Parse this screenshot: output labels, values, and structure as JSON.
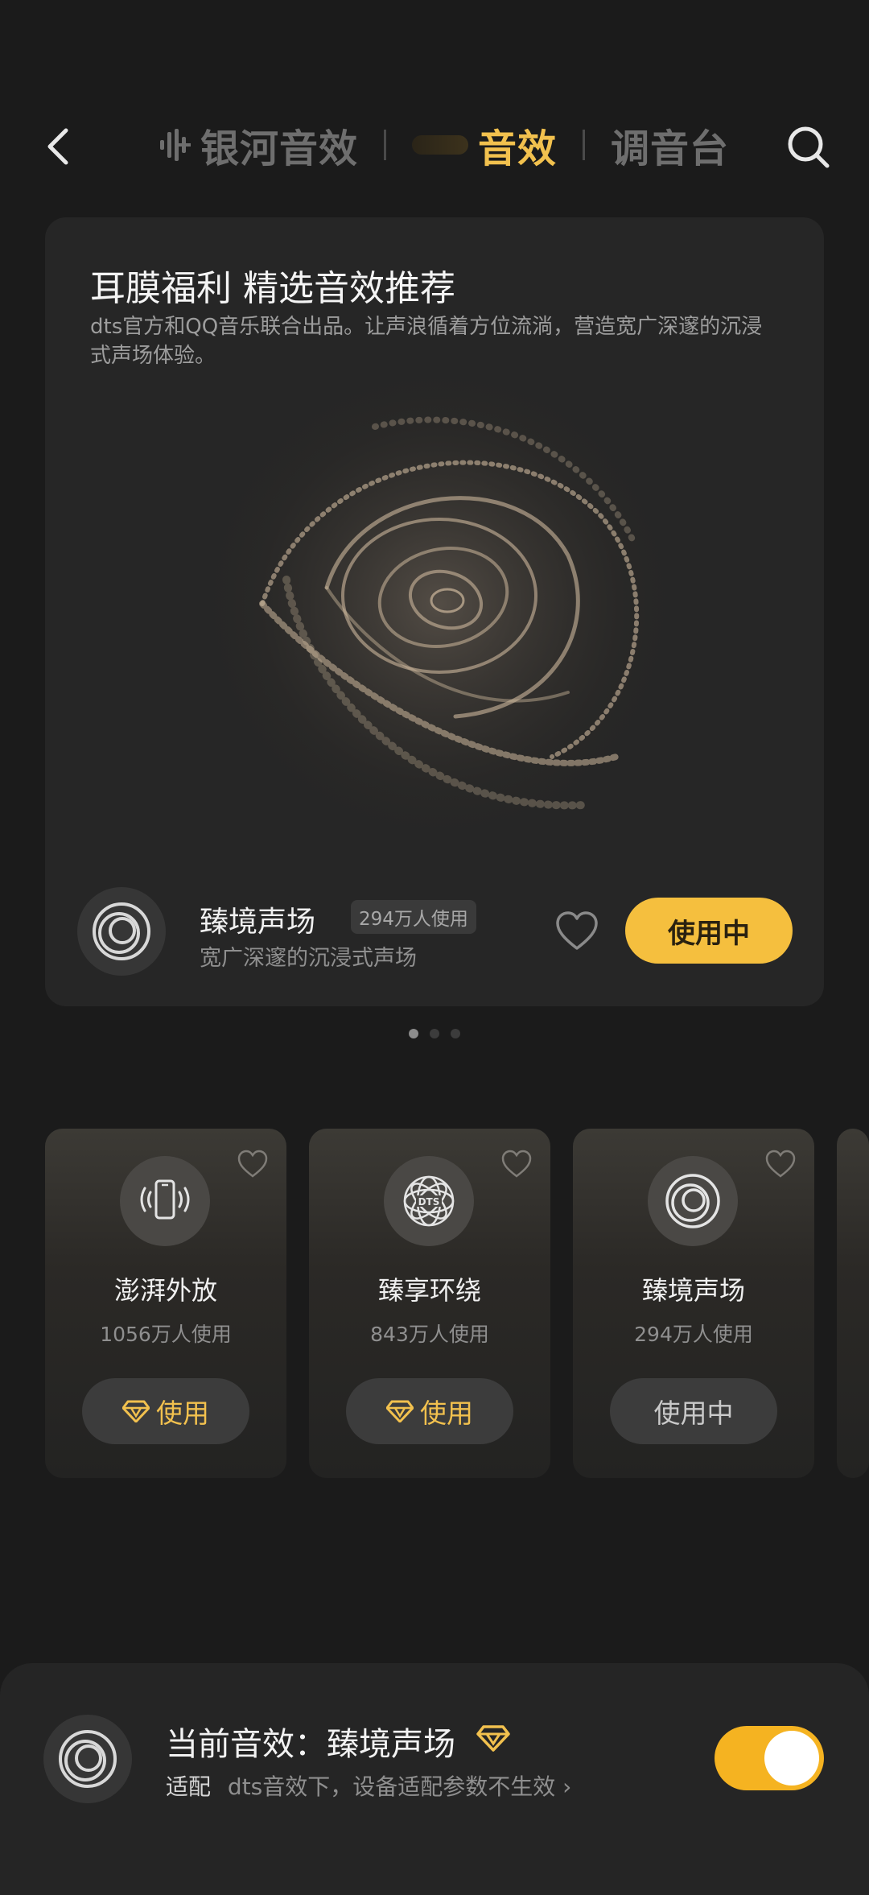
{
  "header": {
    "tabs": [
      {
        "label": "银河音效",
        "icon": "waveform-icon",
        "active": false
      },
      {
        "label": "音效",
        "active": true
      },
      {
        "label": "调音台",
        "active": false
      }
    ]
  },
  "hero": {
    "title": "耳膜福利 精选音效推荐",
    "description": "dts官方和QQ音乐联合出品。让声浪循着方位流淌，营造宽广深邃的沉浸式声场体验。",
    "effect_name": "臻境声场",
    "users": "294万人使用",
    "subtitle": "宽广深邃的沉浸式声场",
    "button": "使用中",
    "page_count": 3,
    "current_page": 1
  },
  "cards": [
    {
      "name": "澎湃外放",
      "count": "1056万人使用",
      "button": "使用",
      "icon": "phone-speaker-icon",
      "vip": true
    },
    {
      "name": "臻享环绕",
      "count": "843万人使用",
      "button": "使用",
      "icon": "dts-icon",
      "vip": true
    },
    {
      "name": "臻境声场",
      "count": "294万人使用",
      "button": "使用中",
      "icon": "rings-icon",
      "vip": false
    }
  ],
  "current": {
    "label": "当前音效：臻境声场",
    "adapt": "适配",
    "note": "dts音效下，设备适配参数不生效",
    "chevron": "›",
    "enabled": true
  },
  "colors": {
    "accent": "#f5bf3e",
    "background": "#1b1b1b",
    "card": "#262626"
  },
  "dts_text": "DTS"
}
